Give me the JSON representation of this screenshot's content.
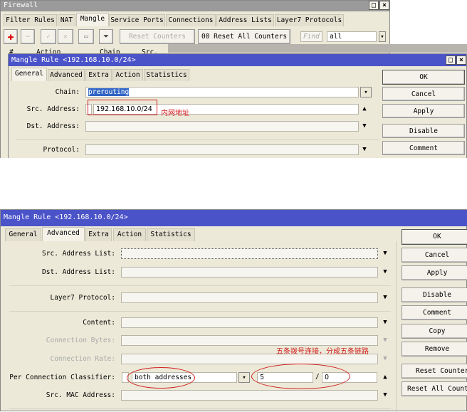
{
  "firewall": {
    "title": "Firewall",
    "tabs": [
      "Filter Rules",
      "NAT",
      "Mangle",
      "Service Ports",
      "Connections",
      "Address Lists",
      "Layer7 Protocols"
    ],
    "toolbar": {
      "reset_counters": "Reset Counters",
      "reset_all": "00 Reset All Counters",
      "find_placeholder": "Find",
      "filter_value": "all"
    },
    "columns": [
      "#",
      "",
      "Action",
      "Chain",
      "Src. Ad"
    ]
  },
  "dialog1": {
    "title": "Mangle Rule <192.168.10.0/24>",
    "tabs": [
      "General",
      "Advanced",
      "Extra",
      "Action",
      "Statistics"
    ],
    "fields": {
      "chain_label": "Chain:",
      "chain_value": "prerouting",
      "src_label": "Src. Address:",
      "src_value": "192.168.10.0/24",
      "dst_label": "Dst. Address:",
      "protocol_label": "Protocol:"
    },
    "annotation": "内网地址",
    "buttons": [
      "OK",
      "Cancel",
      "Apply",
      "Disable",
      "Comment"
    ]
  },
  "dialog2": {
    "title": "Mangle Rule <192.168.10.0/24>",
    "tabs": [
      "General",
      "Advanced",
      "Extra",
      "Action",
      "Statistics"
    ],
    "fields": {
      "src_list": "Src. Address List:",
      "dst_list": "Dst. Address List:",
      "layer7": "Layer7 Protocol:",
      "content": "Content:",
      "conn_bytes": "Connection Bytes:",
      "conn_rate": "Connection Rate:",
      "pcc": "Per Connection Classifier:",
      "pcc_type": "both addresses",
      "pcc_count": "5",
      "pcc_slash": "/",
      "pcc_index": "0",
      "src_mac": "Src. MAC Address:"
    },
    "annotation": "五条拨号连接，分成五条链路",
    "buttons": [
      "OK",
      "Cancel",
      "Apply",
      "Disable",
      "Comment",
      "Copy",
      "Remove",
      "Reset Counters",
      "Reset All Counters"
    ]
  },
  "colors": {
    "title_active": "#4b53c9",
    "annotation": "#d21e1e"
  }
}
